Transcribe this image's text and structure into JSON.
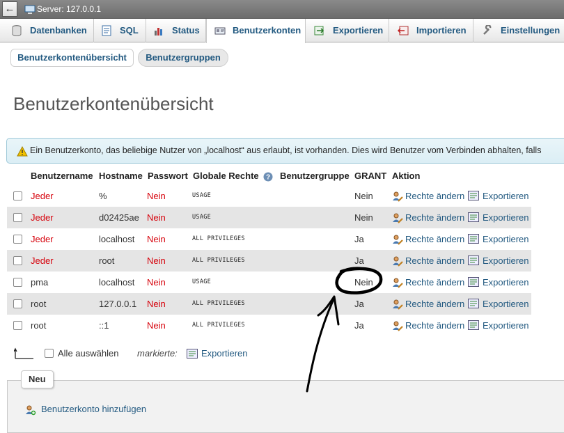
{
  "server_bar": {
    "label": "Server: 127.0.0.1"
  },
  "tabs": [
    {
      "label": "Datenbanken",
      "icon": "database-icon"
    },
    {
      "label": "SQL",
      "icon": "sql-icon"
    },
    {
      "label": "Status",
      "icon": "status-icon"
    },
    {
      "label": "Benutzerkonten",
      "icon": "users-icon",
      "active": true
    },
    {
      "label": "Exportieren",
      "icon": "export-icon"
    },
    {
      "label": "Importieren",
      "icon": "import-icon"
    },
    {
      "label": "Einstellungen",
      "icon": "wrench-icon"
    }
  ],
  "subtabs": {
    "overview": "Benutzerkontenübersicht",
    "groups": "Benutzergruppen"
  },
  "page_title": "Benutzerkontenübersicht",
  "notice": "Ein Benutzerkonto, das beliebige Nutzer von „localhost“ aus erlaubt, ist vorhanden. Dies wird Benutzer vom Verbinden abhalten, falls",
  "table": {
    "headers": {
      "user": "Benutzername",
      "host": "Hostname",
      "password": "Passwort",
      "global": "Globale Rechte",
      "group": "Benutzergruppe",
      "grant": "GRANT",
      "action": "Aktion"
    },
    "rows": [
      {
        "user": "Jeder",
        "host": "%",
        "password": "Nein",
        "global": "USAGE",
        "grant": "Nein",
        "edit": "Rechte ändern",
        "export": "Exportieren"
      },
      {
        "user": "Jeder",
        "host": "d02425ae",
        "password": "Nein",
        "global": "USAGE",
        "grant": "Nein",
        "edit": "Rechte ändern",
        "export": "Exportieren"
      },
      {
        "user": "Jeder",
        "host": "localhost",
        "password": "Nein",
        "global": "ALL PRIVILEGES",
        "grant": "Ja",
        "edit": "Rechte ändern",
        "export": "Exportieren"
      },
      {
        "user": "Jeder",
        "host": "root",
        "password": "Nein",
        "global": "ALL PRIVILEGES",
        "grant": "Ja",
        "edit": "Rechte ändern",
        "export": "Exportieren"
      },
      {
        "user": "pma",
        "host": "localhost",
        "password": "Nein",
        "global": "USAGE",
        "grant": "Nein",
        "edit": "Rechte ändern",
        "export": "Exportieren"
      },
      {
        "user": "root",
        "host": "127.0.0.1",
        "password": "Nein",
        "global": "ALL PRIVILEGES",
        "grant": "Ja",
        "edit": "Rechte ändern",
        "export": "Exportieren"
      },
      {
        "user": "root",
        "host": "::1",
        "password": "Nein",
        "global": "ALL PRIVILEGES",
        "grant": "Ja",
        "edit": "Rechte ändern",
        "export": "Exportieren"
      }
    ]
  },
  "footer": {
    "select_all": "Alle auswählen",
    "marked": "markierte:",
    "export": "Exportieren"
  },
  "new_section": {
    "legend": "Neu",
    "add_user": "Benutzerkonto hinzufügen"
  },
  "colors": {
    "link": "#235a81",
    "red": "#d6000a"
  }
}
